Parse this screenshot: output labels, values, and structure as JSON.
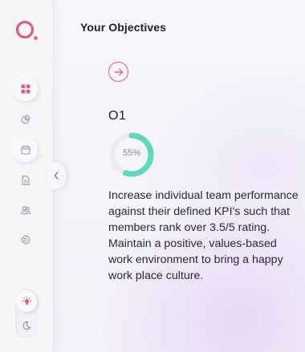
{
  "page": {
    "title": "Your Objectives"
  },
  "sidebar": {
    "items": [
      {
        "name": "dashboard",
        "icon": "grid-icon",
        "active": true
      },
      {
        "name": "analytics",
        "icon": "pie-chart-icon",
        "active": false
      },
      {
        "name": "calendar",
        "icon": "calendar-icon",
        "active": false
      },
      {
        "name": "documents",
        "icon": "document-icon",
        "active": false
      },
      {
        "name": "team",
        "icon": "users-icon",
        "active": false
      },
      {
        "name": "settings",
        "icon": "gear-icon",
        "active": false
      }
    ],
    "theme_toggle": {
      "selected": "light",
      "options": [
        "light",
        "dark"
      ]
    }
  },
  "objective": {
    "code": "O1",
    "progress_percent": 55,
    "progress_label": "55%",
    "description_lines": [
      "Increase individual team performance",
      "against their defined KPI's such that",
      "members rank over 3.5/5 rating.",
      "Maintain a positive, values-based",
      "work environment to bring a happy",
      "work place culture."
    ]
  },
  "colors": {
    "accent": "#e6577f",
    "progress": "#5fd8c0",
    "progress_track": "#ebebf0",
    "sidebar_bg": "#f6f6f9"
  }
}
